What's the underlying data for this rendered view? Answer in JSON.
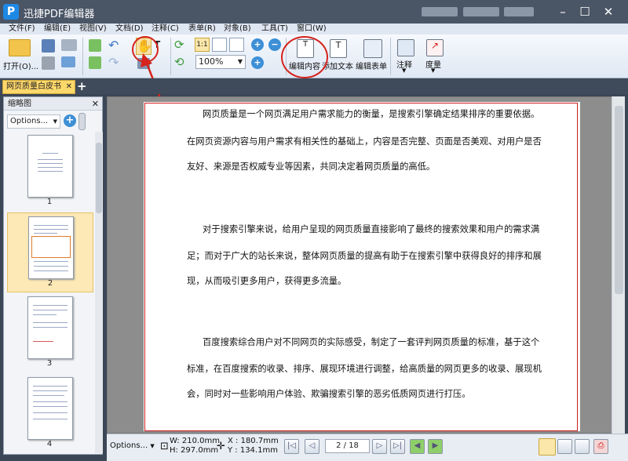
{
  "window": {
    "title": "迅捷PDF编辑器"
  },
  "menu": [
    "文件(F)",
    "编辑(E)",
    "视图(V)",
    "文档(D)",
    "注释(C)",
    "表单(R)",
    "对象(B)",
    "工具(T)",
    "窗口(W)"
  ],
  "toolbar": {
    "open_label": "打开(O)...",
    "zoom_value": "100%",
    "edit_content_label": "编辑内容",
    "add_text_label": "添加文本",
    "edit_form_label": "编辑表单",
    "annotate_label": "注释",
    "measure_label": "度量"
  },
  "tabs": [
    {
      "label": "网页质量白皮书"
    }
  ],
  "thumbnails": {
    "title": "缩略图",
    "options_label": "Options...",
    "pages": [
      "1",
      "2",
      "3",
      "4"
    ],
    "selected_page": "2"
  },
  "document": {
    "lines": [
      "网页质量是一个网页满足用户需求能力的衡量，是搜索引擎确定结果排序的重要依据。",
      "在网页资源内容与用户需求有相关性的基础上，内容是否完整、页面是否美观、对用户是否",
      "友好、来源是否权威专业等因素，共同决定着网页质量的高低。",
      "对于搜索引擎来说，给用户呈现的网页质量直接影响了最终的搜索效果和用户的需求满",
      "足；而对于广大的站长来说，整体网页质量的提高有助于在搜索引擎中获得良好的排序和展",
      "现，从而吸引更多用户，获得更多流量。",
      "百度搜索综合用户对不同网页的实际感受，制定了一套评判网页质量的标准，基于这个",
      "标准，在百度搜索的收录、排序、展现环境进行调整，给高质量的网页更多的收录、展现机",
      "会，同时对一些影响用户体验、欺骗搜索引擎的恶劣低质网页进行打压。"
    ]
  },
  "statusbar": {
    "options_label": "Options...",
    "width": "W: 210.0mm",
    "height": "H: 297.0mm",
    "x_coord": "X : 180.7mm",
    "y_coord": "Y : 134.1mm",
    "page_current": "2",
    "page_total": "18"
  },
  "colors": {
    "accent": "#d6231d",
    "selection": "#fde9b5",
    "tab_active": "#ffd86b"
  }
}
